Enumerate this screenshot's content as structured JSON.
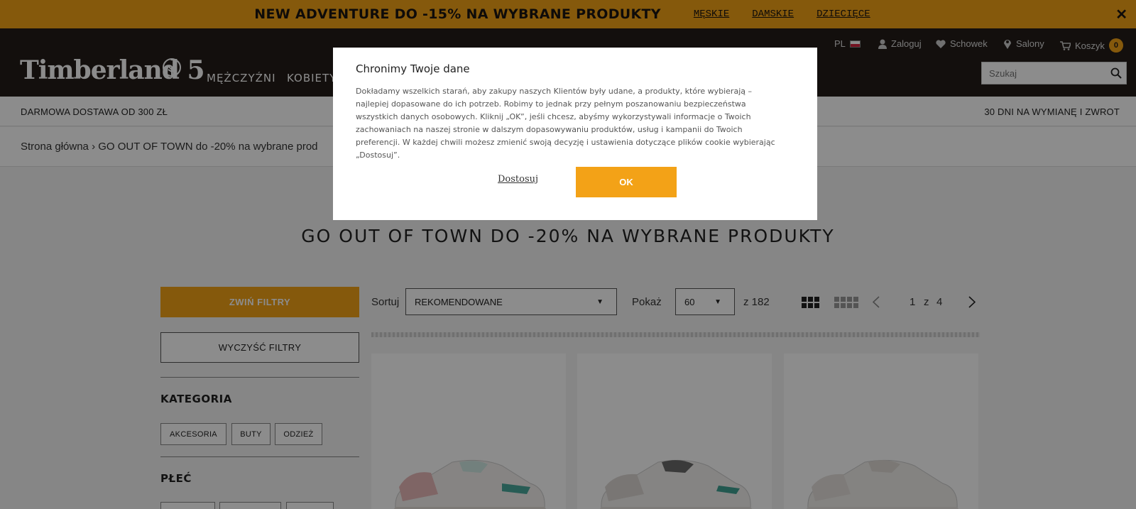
{
  "promo": {
    "text": "NEW ADVENTURE DO -15% NA WYBRANE PRODUKTY",
    "links": [
      "MĘSKIE",
      "DAMSKIE",
      "DZIECIĘCE"
    ],
    "close": "✕"
  },
  "header": {
    "logo": "Timberland 5",
    "nav": [
      "MĘŻCZYŹNI",
      "KOBIETY"
    ],
    "language": "PL",
    "login": "Zaloguj",
    "wishlist": "Schowek",
    "stores": "Salony",
    "cart": "Koszyk",
    "cart_count": "0",
    "search_placeholder": "Szukaj"
  },
  "infobar": {
    "left": "DARMOWA DOSTAWA OD 300 ZŁ",
    "right": "30 DNI NA WYMIANĘ I ZWROT"
  },
  "breadcrumb": "Strona główna › GO OUT OF TOWN do -20% na wybrane prod",
  "page_title": "GO OUT OF TOWN DO -20% NA WYBRANE PRODUKTY",
  "filters": {
    "collapse": "ZWIŃ FILTRY",
    "clear": "WYCZYŚĆ FILTRY",
    "category_title": "KATEGORIA",
    "categories": [
      "AKCESORIA",
      "BUTY",
      "ODZIEŻ"
    ],
    "gender_title": "PŁEĆ"
  },
  "toolbar": {
    "sort_label": "Sortuj",
    "sort_value": "REKOMENDOWANE",
    "show_label": "Pokaż",
    "show_value": "60",
    "total": "z 182",
    "page_current": "1",
    "page_of": "z",
    "page_total": "4"
  },
  "modal": {
    "title": "Chronimy Twoje dane",
    "body": "Dokładamy wszelkich starań, aby zakupy naszych Klientów były udane, a produkty, które wybierają – najlepiej dopasowane do ich potrzeb. Robimy to jednak przy pełnym poszanowaniu bezpieczeństwa wszystkich danych osobowych. Kliknij „OK”, jeśli chcesz, abyśmy wykorzystywali informacje o Twoich zachowaniach na naszej stronie w dalszym dopasowywaniu produktów, usług i kampanii do Twoich preferencji. W każdej chwili możesz zmienić swoją decyzję i ustawienia dotyczące plików cookie wybierając „Dostosuj”.",
    "customize": "Dostosuj",
    "ok": "OK"
  },
  "colors": {
    "accent": "#f3a217",
    "header_bg": "#231c19"
  }
}
